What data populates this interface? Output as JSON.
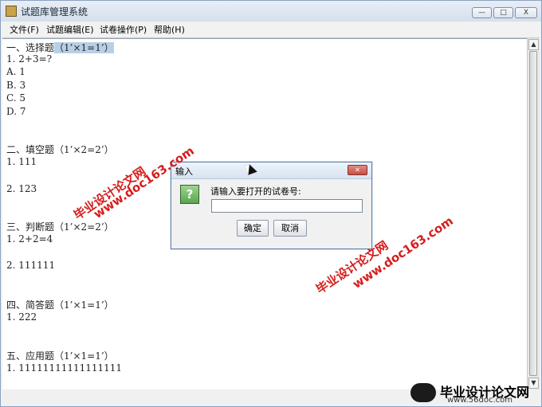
{
  "window": {
    "title": "试题库管理系统",
    "controls": {
      "minimize": "—",
      "maximize": "□",
      "close": "X"
    }
  },
  "menu": [
    {
      "label": "文件(F)"
    },
    {
      "label": "试题编辑(E)"
    },
    {
      "label": "试卷操作(P)"
    },
    {
      "label": "帮助(H)"
    }
  ],
  "content_lines": [
    "一、选择题（1’×1=1’）",
    "1. 2+3=?",
    "A. 1",
    "B. 3",
    "C. 5",
    "D. 7",
    "",
    "",
    "二、填空题（1’×2=2’）",
    "1. 111",
    "",
    "2. 123",
    "",
    "",
    "三、判断题（1’×2=2’）",
    "1. 2+2=4",
    "",
    "2. 111111",
    "",
    "",
    "四、简答题（1’×1=1’）",
    "1. 222",
    "",
    "",
    "五、应用题（1’×1=1’）",
    "1. 11111111111111111"
  ],
  "dialog": {
    "title": "输入",
    "icon": "question-icon",
    "prompt": "请输入要打开的试卷号:",
    "input_value": "",
    "ok_label": "确定",
    "cancel_label": "取消"
  },
  "watermarks": [
    "毕业设计论文网",
    "www.doc163.com",
    "毕业设计论文网",
    "www.doc163.com"
  ],
  "branding": {
    "name": "毕业设计论文网",
    "url": "www.56doc.com"
  },
  "colors": {
    "highlight": "#b8cfe5",
    "watermark": "#d61d1d"
  }
}
